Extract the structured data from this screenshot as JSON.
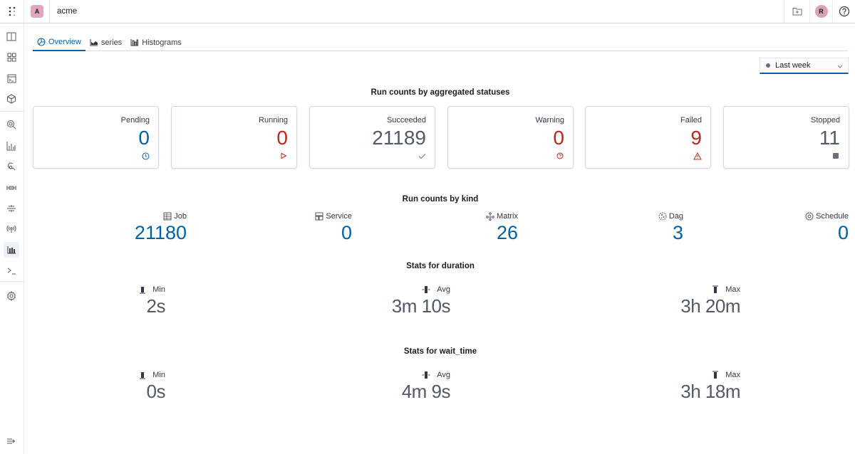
{
  "topbar": {
    "org_initial": "A",
    "org_name": "acme",
    "user_initial": "R",
    "icons": [
      "apps-menu-icon",
      "new-folder-icon",
      "user-avatar",
      "help-icon"
    ]
  },
  "sidebar": {
    "items": [
      {
        "name": "sidebar-item-projects",
        "icon": "columns-icon"
      },
      {
        "name": "sidebar-item-dashboards",
        "icon": "grid-icon"
      },
      {
        "name": "sidebar-item-runs",
        "icon": "console-window-icon"
      },
      {
        "name": "sidebar-item-components",
        "icon": "package-icon"
      },
      {
        "name": "sidebar-item-search",
        "icon": "search-icon"
      },
      {
        "name": "sidebar-item-analytics",
        "icon": "bar-chart-icon"
      },
      {
        "name": "sidebar-item-agents",
        "icon": "link-icon"
      },
      {
        "name": "sidebar-item-connections",
        "icon": "connection-icon"
      },
      {
        "name": "sidebar-item-queues",
        "icon": "queue-icon"
      },
      {
        "name": "sidebar-item-streams",
        "icon": "broadcast-icon"
      },
      {
        "name": "sidebar-item-stats",
        "icon": "histogram-icon",
        "active": true
      },
      {
        "name": "sidebar-item-cli",
        "icon": "terminal-icon"
      },
      {
        "name": "sidebar-item-settings",
        "icon": "gear-icon"
      }
    ],
    "collapse_icon": "expand-sidebar-icon"
  },
  "tabs": [
    {
      "label": "Overview",
      "icon": "overview-icon",
      "active": true
    },
    {
      "label": "series",
      "icon": "area-chart-icon",
      "active": false
    },
    {
      "label": "Histograms",
      "icon": "histogram-icon",
      "active": false
    }
  ],
  "date_filter": {
    "selected": "Last week"
  },
  "status_section": {
    "title": "Run counts by aggregated statuses",
    "cards": [
      {
        "label": "Pending",
        "value": "0",
        "icon": "clock-icon",
        "color": "#0061a6"
      },
      {
        "label": "Running",
        "value": "0",
        "icon": "play-icon",
        "color": "#bd271e"
      },
      {
        "label": "Succeeded",
        "value": "21189",
        "icon": "check-icon",
        "color": "#535966"
      },
      {
        "label": "Warning",
        "value": "0",
        "icon": "question-circle-icon",
        "color": "#bd271e"
      },
      {
        "label": "Failed",
        "value": "9",
        "icon": "warning-triangle-icon",
        "color": "#bd271e"
      },
      {
        "label": "Stopped",
        "value": "11",
        "icon": "stop-square-icon",
        "color": "#535966"
      }
    ]
  },
  "kind_section": {
    "title": "Run counts by kind",
    "items": [
      {
        "label": "Job",
        "value": "21180",
        "icon": "table-icon"
      },
      {
        "label": "Service",
        "value": "0",
        "icon": "service-icon"
      },
      {
        "label": "Matrix",
        "value": "26",
        "icon": "matrix-icon"
      },
      {
        "label": "Dag",
        "value": "3",
        "icon": "dag-icon"
      },
      {
        "label": "Schedule",
        "value": "0",
        "icon": "schedule-icon"
      }
    ]
  },
  "duration_section": {
    "title": "Stats for duration",
    "items": [
      {
        "label": "Min",
        "value": "2s",
        "icon": "min-bar-icon"
      },
      {
        "label": "Avg",
        "value": "3m 10s",
        "icon": "avg-bar-icon"
      },
      {
        "label": "Max",
        "value": "3h 20m",
        "icon": "max-bar-icon"
      }
    ]
  },
  "wait_section": {
    "title": "Stats for wait_time",
    "items": [
      {
        "label": "Min",
        "value": "0s",
        "icon": "min-bar-icon"
      },
      {
        "label": "Avg",
        "value": "4m 9s",
        "icon": "avg-bar-icon"
      },
      {
        "label": "Max",
        "value": "3h 18m",
        "icon": "max-bar-icon"
      }
    ]
  }
}
